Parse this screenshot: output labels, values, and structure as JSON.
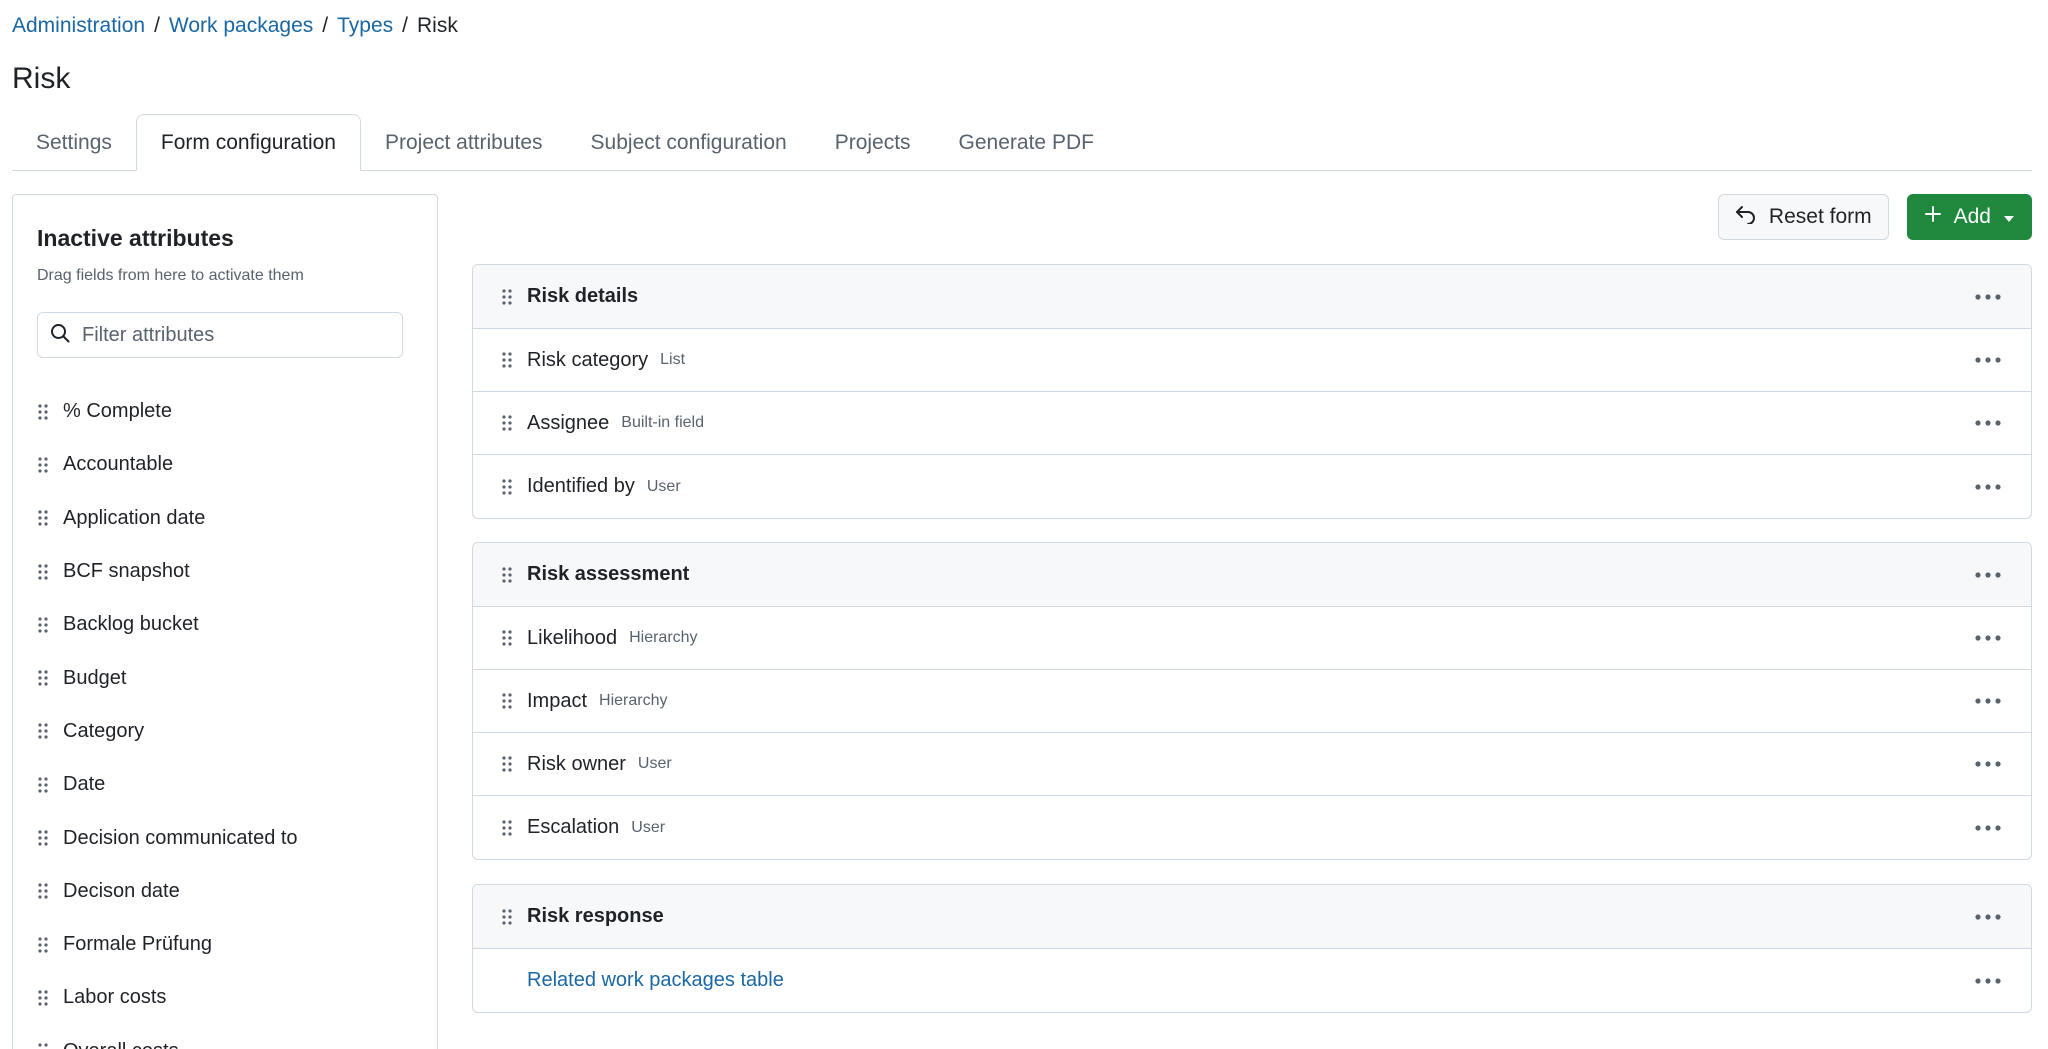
{
  "breadcrumb": {
    "items": [
      "Administration",
      "Work packages",
      "Types"
    ],
    "current": "Risk"
  },
  "page": {
    "title": "Risk"
  },
  "tabs": [
    {
      "label": "Settings",
      "active": false
    },
    {
      "label": "Form configuration",
      "active": true
    },
    {
      "label": "Project attributes",
      "active": false
    },
    {
      "label": "Subject configuration",
      "active": false
    },
    {
      "label": "Projects",
      "active": false
    },
    {
      "label": "Generate PDF",
      "active": false
    }
  ],
  "sidebar": {
    "title": "Inactive attributes",
    "subtitle": "Drag fields from here to activate them",
    "filter_placeholder": "Filter attributes",
    "items": [
      "% Complete",
      "Accountable",
      "Application date",
      "BCF snapshot",
      "Backlog bucket",
      "Budget",
      "Category",
      "Date",
      "Decision communicated to",
      "Decison date",
      "Formale Prüfung",
      "Labor costs",
      "Overall costs"
    ]
  },
  "toolbar": {
    "reset_label": "Reset form",
    "add_label": "Add"
  },
  "groups": [
    {
      "name": "Risk details",
      "rows": [
        {
          "label": "Risk category",
          "type": "List"
        },
        {
          "label": "Assignee",
          "type": "Built-in field"
        },
        {
          "label": "Identified by",
          "type": "User"
        }
      ]
    },
    {
      "name": "Risk assessment",
      "rows": [
        {
          "label": "Likelihood",
          "type": "Hierarchy"
        },
        {
          "label": "Impact",
          "type": "Hierarchy"
        },
        {
          "label": "Risk owner",
          "type": "User"
        },
        {
          "label": "Escalation",
          "type": "User"
        }
      ]
    },
    {
      "name": "Risk response",
      "link": "Related work packages table"
    }
  ],
  "colors": {
    "link": "#1a67a3",
    "primary_button": "#1f883d",
    "border": "#d1d9e0",
    "header_bg": "#f6f8fa",
    "muted_text": "#59636e"
  }
}
